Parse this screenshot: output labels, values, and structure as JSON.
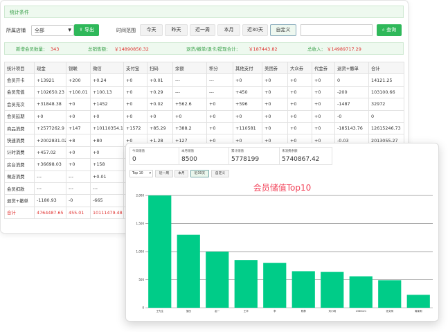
{
  "filter": {
    "title": "统计条件",
    "store_label": "所属店铺",
    "store_value": "全部",
    "export_label": "导出",
    "time_label": "时间范围",
    "time_buttons": [
      "今天",
      "昨天",
      "近一周",
      "本月",
      "近30天",
      "自定义"
    ],
    "query_label": "查询"
  },
  "summary": {
    "new_members_label": "新增会员数量：",
    "new_members_value": "343",
    "total_sales_label": "总销售额：",
    "total_sales_value": "￥14890850.32",
    "refund_label": "退货/撤单/退卡/提现合计：",
    "refund_value": "￥187443.82",
    "total_income_label": "总收入：",
    "total_income_value": "￥14989717.29"
  },
  "table": {
    "headers": [
      "统计项目",
      "现金",
      "银联",
      "微信",
      "支付宝",
      "扫码",
      "余额",
      "积分",
      "其他支付",
      "美团券",
      "大众券",
      "代金券",
      "退货+撤单",
      "合计"
    ],
    "rows": [
      [
        "会员开卡",
        "+13921",
        "+200",
        "+0.24",
        "+0",
        "+0.01",
        "---",
        "---",
        "+0",
        "+0",
        "+0",
        "+0",
        "0",
        "14121.25"
      ],
      [
        "会员充值",
        "+102650.23",
        "+100.01",
        "+100.13",
        "+0",
        "+0.29",
        "---",
        "---",
        "+450",
        "+0",
        "+0",
        "+0",
        "-200",
        "103100.66"
      ],
      [
        "会员充次",
        "+31848.38",
        "+0",
        "+1452",
        "+0",
        "+0.02",
        "+562.6",
        "+0",
        "+596",
        "+0",
        "+0",
        "+0",
        "-1487",
        "32972"
      ],
      [
        "会员延期",
        "+0",
        "+0",
        "+0",
        "+0",
        "+0",
        "+0",
        "+0",
        "+0",
        "+0",
        "+0",
        "+0",
        "-0",
        "0"
      ],
      [
        "商品消费",
        "+2577262.9",
        "+147",
        "+10110354.1",
        "+1572",
        "+85.29",
        "+388.2",
        "+0",
        "+110581",
        "+0",
        "+0",
        "+0",
        "-185143.76",
        "12615246.73"
      ],
      [
        "快速消费",
        "+2002831.02",
        "+8",
        "+80",
        "+0",
        "+1.28",
        "+127",
        "+0",
        "+0",
        "+0",
        "+0",
        "+0",
        "-0.03",
        "2013055.27"
      ],
      [
        "计时消费",
        "+457.02",
        "+0",
        "+0",
        "",
        "",
        "",
        "",
        "",
        "",
        "",
        "",
        "",
        ""
      ],
      [
        "房台消费",
        "+36698.03",
        "+0",
        "+158",
        "",
        "",
        "",
        "",
        "",
        "",
        "",
        "",
        "",
        ""
      ],
      [
        "做店消费",
        "---",
        "---",
        "+0.01",
        "",
        "",
        "",
        "",
        "",
        "",
        "",
        "",
        "",
        ""
      ],
      [
        "会员扣款",
        "---",
        "---",
        "---",
        "",
        "",
        "",
        "",
        "",
        "",
        "",
        "",
        "",
        ""
      ],
      [
        "退货+撤单",
        "-1180.93",
        "-0",
        "-665",
        "",
        "",
        "",
        "",
        "",
        "",
        "",
        "",
        "",
        ""
      ],
      [
        "合计",
        "4764487.65",
        "455.01",
        "10111479.48",
        "",
        "",
        "",
        "",
        "",
        "",
        "",
        "",
        "",
        ""
      ]
    ]
  },
  "panel": {
    "stats": [
      {
        "caption": "今日储值",
        "value": "0"
      },
      {
        "caption": "本月储值",
        "value": "8500"
      },
      {
        "caption": "累计储值",
        "value": "5778199"
      },
      {
        "caption": "未消费余额",
        "value": "5740867.42"
      }
    ],
    "select_value": "Top 10",
    "range_buttons": [
      "近一周",
      "本月",
      "近30天",
      "自定义"
    ]
  },
  "chart_data": {
    "type": "bar",
    "title": "会员储值Top10",
    "categories": [
      "王先生",
      "邹四",
      "赵一",
      "王华",
      "李",
      "陈静",
      "刘小明",
      "1380021",
      "张文明",
      "周某明"
    ],
    "values": [
      2000,
      1300,
      1000,
      850,
      800,
      650,
      640,
      560,
      490,
      230
    ],
    "ylim": [
      0,
      2000
    ],
    "yticks": [
      0,
      500,
      1000,
      1500,
      2000
    ],
    "ytick_labels": [
      "0",
      "500",
      "1,000",
      "1,500",
      "2,000"
    ],
    "xlabel": "",
    "ylabel": "",
    "bar_color": "#00cc88",
    "grid": true
  }
}
